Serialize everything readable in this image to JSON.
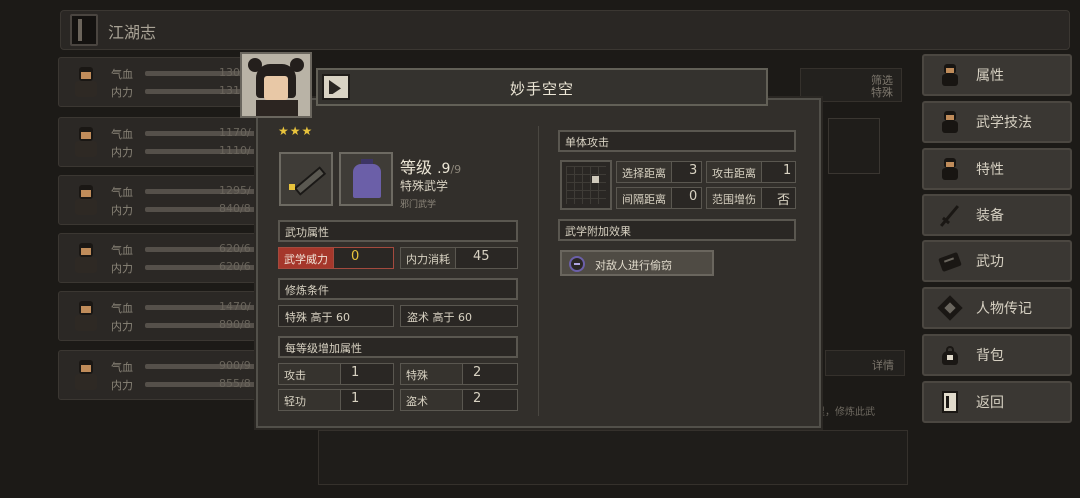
{
  "top": {
    "title": "江湖志"
  },
  "roster": [
    {
      "hp_label": "气血",
      "mp_label": "内力",
      "hp": "130",
      "mp": "131"
    },
    {
      "hp_label": "气血",
      "mp_label": "内力",
      "hp": "1170/",
      "mp": "1110/"
    },
    {
      "hp_label": "气血",
      "mp_label": "内力",
      "hp": "1295/",
      "mp": "840/8"
    },
    {
      "hp_label": "气血",
      "mp_label": "内力",
      "hp": "620/6",
      "mp": "620/6"
    },
    {
      "hp_label": "气血",
      "mp_label": "内力",
      "hp": "1470/",
      "mp": "890/8"
    },
    {
      "hp_label": "气血",
      "mp_label": "内力",
      "hp": "900/9",
      "mp": "855/8"
    }
  ],
  "side_menu": [
    {
      "label": "属性",
      "icon": "character-icon"
    },
    {
      "label": "武学技法",
      "icon": "character-icon"
    },
    {
      "label": "特性",
      "icon": "character-icon"
    },
    {
      "label": "装备",
      "icon": "sword-icon"
    },
    {
      "label": "武功",
      "icon": "scroll-icon"
    },
    {
      "label": "人物传记",
      "icon": "book-icon"
    },
    {
      "label": "背包",
      "icon": "bag-icon"
    },
    {
      "label": "返回",
      "icon": "exit-door-icon"
    }
  ],
  "background": {
    "filter_line1": "筛选",
    "filter_line2": "特殊",
    "detail": "详情",
    "note": "里，修炼此武"
  },
  "dialog": {
    "title": "妙手空空",
    "stars": "★★★",
    "level_label": "等级",
    "level_current": ".9",
    "level_max": "/9",
    "category": "特殊武学",
    "sect": "邪门武学",
    "attr_header": "武功属性",
    "power_label": "武学威力",
    "power_value": "0",
    "mp_cost_label": "内力消耗",
    "mp_cost_value": "45",
    "req_header": "修炼条件",
    "req1": "特殊 高于 60",
    "req2": "盗术 高于 60",
    "per_level_header": "每等级增加属性",
    "gains": [
      {
        "label": "攻击",
        "value": "1"
      },
      {
        "label": "特殊",
        "value": "2"
      },
      {
        "label": "轻功",
        "value": "1"
      },
      {
        "label": "盗术",
        "value": "2"
      }
    ],
    "target_header": "单体攻击",
    "select_range_label": "选择距离",
    "select_range_value": "3",
    "attack_range_label": "攻击距离",
    "attack_range_value": "1",
    "interval_label": "间隔距离",
    "interval_value": "0",
    "aoe_label": "范围增伤",
    "aoe_value": "否",
    "effect_header": "武学附加效果",
    "effect_label": "对敌人进行偷窃"
  },
  "colors": {
    "accent_gold": "#e8c33c",
    "highlight_red": "#a5372b",
    "effect_purple": "#6b5fa8"
  }
}
